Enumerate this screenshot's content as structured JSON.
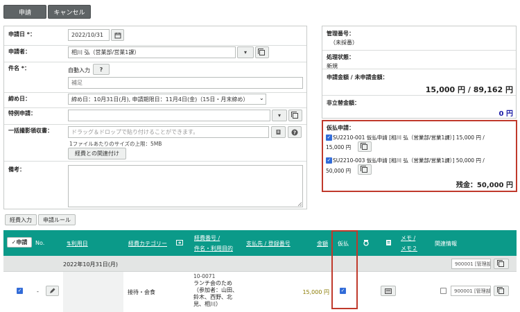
{
  "toolbar": {
    "apply_label": "申請",
    "cancel_label": "キャンセル"
  },
  "form": {
    "date_label": "申請日 *：",
    "date_value": "2022/10/31",
    "applicant_label": "申請者：",
    "applicant_value": "相川 弘（営業部/営業1課）",
    "subject_label": "件名 *：",
    "subject_auto": "自動入力",
    "subject_help": "?",
    "subject_value": "補足",
    "deadline_label": "締め日：",
    "deadline_value": "締め日：10月31日(月), 申請期限日：11月4日(金)（15日・月末締め）",
    "special_label": "特例申請：",
    "special_value": "",
    "receipt_label": "一括撮影領収書：",
    "receipt_placeholder": "ドラッグ＆ドロップで貼り付けることができます。",
    "receipt_note": "1ファイルあたりのサイズの上限：5MB",
    "link_expense_label": "経費との関連付け",
    "remarks_label": "備考："
  },
  "info": {
    "mgmt_no_label": "管理番号：",
    "mgmt_no_value": "（未採番）",
    "status_label": "処理状態：",
    "status_value": "新規",
    "amount_label": "申請金額 / 未申請金額：",
    "amount_value": "15,000 円 / 89,162 円",
    "nonreimb_label": "非立替金額：",
    "nonreimb_value": "0 円"
  },
  "advance": {
    "title": "仮払申請：",
    "items": [
      {
        "line1": "SU2210-001 仮払申請 [相川 弘（営業部/営業1課）] 15,000 円 /",
        "line2": "15,000 円"
      },
      {
        "line1": "SU2210-003 仮払申請 [相川 弘（営業部/営業1課）] 50,000 円 /",
        "line2": "50,000 円"
      }
    ],
    "balance": "残金：50,000 円"
  },
  "tabs": {
    "expense_input": "経費入力",
    "apply_rule": "申請ルール"
  },
  "table": {
    "accent": "#0b9a89",
    "headers": {
      "apply": "✓申請",
      "no": "No.",
      "date": "利用日",
      "category": "経費カテゴリー",
      "expense_no": "経費番号 /",
      "item_purpose": "件名・利用目的",
      "payee": "支払先 / 登録番号",
      "amount": "金額",
      "advance": "仮払",
      "memo": "メモ /",
      "memo2": "メモ２",
      "related": "関連情報"
    },
    "group_label": "2022年10月31日(月)",
    "group_related": "900001 [管理部",
    "row": {
      "no": "-",
      "category": "接待・会食",
      "expense_no": "10-0071",
      "purpose_lines": [
        "ランチ会のため",
        "（参加者：山田、",
        "鈴木、西野、北",
        "見、相川）"
      ],
      "amount": "15,000 円",
      "related": "900001 [管理部"
    }
  },
  "colors": {
    "header_teal": "#0b9a89",
    "highlight_red": "#c0392b",
    "accent_blue": "#1a1aa6"
  }
}
